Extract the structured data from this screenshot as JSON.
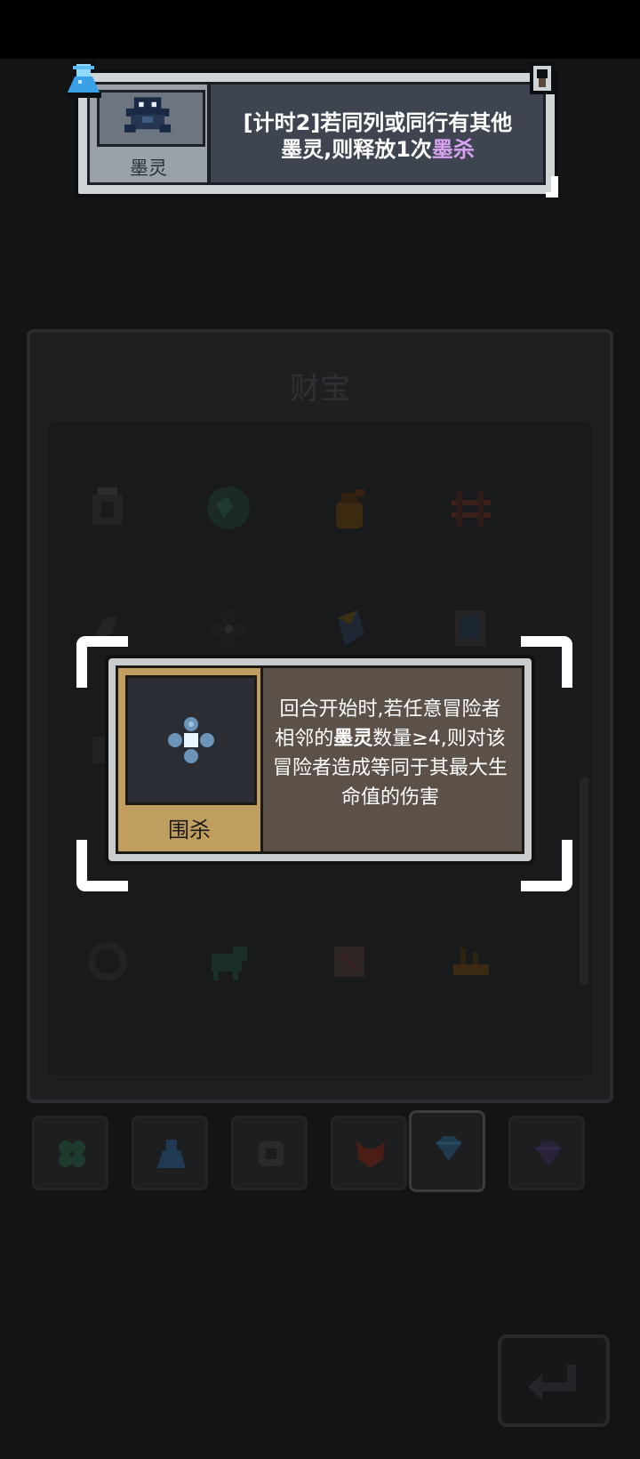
{
  "top_card": {
    "icon": "ink-spirit-icon",
    "name": "墨灵",
    "desc_part1": "[计时2]若同列或同行有其他",
    "desc_part2": "墨灵",
    "desc_part3": ",则释放1次",
    "desc_keyword": "墨杀",
    "keyword_color": "#d8a2f0",
    "badge_left": "flask-icon",
    "badge_right": "lock-icon"
  },
  "panel": {
    "title": "财宝",
    "items": [
      {
        "icon": "rune-stone-icon"
      },
      {
        "icon": "globe-icon"
      },
      {
        "icon": "bag-icon"
      },
      {
        "icon": "fence-icon"
      },
      {
        "icon": "crow-icon"
      },
      {
        "icon": "clover-icon"
      },
      {
        "icon": "crystal-icon"
      },
      {
        "icon": "frame-icon"
      },
      {
        "icon": "scroll-icon"
      },
      {
        "icon": "arrow-icon"
      },
      {
        "icon": "sword-icon"
      },
      {
        "icon": "carrot-icon"
      },
      {
        "icon": "ring-icon"
      },
      {
        "icon": "dog-icon"
      },
      {
        "icon": "map-icon"
      },
      {
        "icon": "ship-icon"
      }
    ]
  },
  "tabs": [
    {
      "icon": "clover-tab-icon"
    },
    {
      "icon": "flask-tab-icon"
    },
    {
      "icon": "dice-tab-icon"
    },
    {
      "icon": "fox-tab-icon"
    },
    {
      "icon": "diamond-tab-icon",
      "active": true
    },
    {
      "icon": "diamond-outline-tab-icon"
    }
  ],
  "tooltip": {
    "icon": "cross-dots-icon",
    "name": "围杀",
    "desc_a": "回合开始时,若任意冒险者相邻的",
    "desc_kw": "墨灵",
    "desc_b": "数量≥4,则对该冒险者造成等同于其最大生命值的伤害"
  },
  "back_button": {
    "icon": "return-arrow-icon"
  }
}
